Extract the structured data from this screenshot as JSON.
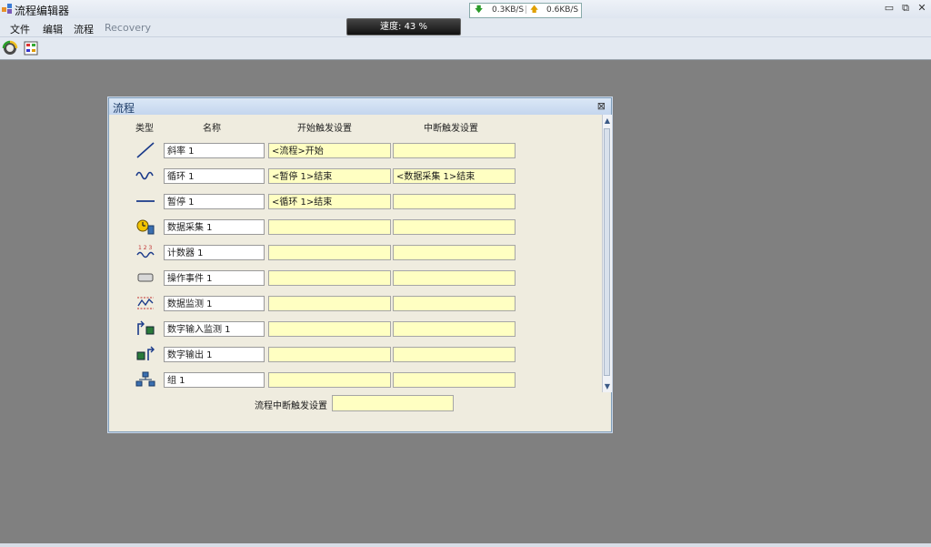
{
  "app": {
    "title": "流程编辑器"
  },
  "window_controls": [
    "minimize-icon",
    "restore-icon",
    "close-icon"
  ],
  "menu": {
    "items": [
      "文件",
      "编辑",
      "流程",
      "Recovery"
    ]
  },
  "toolbar": {
    "buttons": [
      "refresh-icon",
      "edit-flow-icon"
    ]
  },
  "speed": {
    "label": "速度: 43 %"
  },
  "network": {
    "down": "0.3KB/S",
    "up": "0.6KB/S"
  },
  "dialog": {
    "title": "流程",
    "columns": {
      "type": "类型",
      "name": "名称",
      "start": "开始触发设置",
      "stop": "中断触发设置"
    },
    "rows": [
      {
        "icon": "ramp-icon",
        "name": "斜率 1",
        "start": "<流程>开始",
        "stop": ""
      },
      {
        "icon": "cycle-wave-icon",
        "name": "循环 1",
        "start": "<暂停 1>结束",
        "stop": "<数据采集 1>结束"
      },
      {
        "icon": "hold-line-icon",
        "name": "暂停 1",
        "start": "<循环 1>结束",
        "stop": ""
      },
      {
        "icon": "data-acquire-icon",
        "name": "数据采集 1",
        "start": "",
        "stop": ""
      },
      {
        "icon": "counter-icon",
        "name": "计数器 1",
        "start": "",
        "stop": ""
      },
      {
        "icon": "operator-event-icon",
        "name": "操作事件 1",
        "start": "",
        "stop": ""
      },
      {
        "icon": "data-monitor-icon",
        "name": "数据监测 1",
        "start": "",
        "stop": ""
      },
      {
        "icon": "digital-input-icon",
        "name": "数字输入监测 1",
        "start": "",
        "stop": ""
      },
      {
        "icon": "digital-output-icon",
        "name": "数字输出 1",
        "start": "",
        "stop": ""
      },
      {
        "icon": "group-icon",
        "name": "组 1",
        "start": "",
        "stop": ""
      }
    ],
    "footer": {
      "label": "流程中断触发设置",
      "value": ""
    }
  },
  "colors": {
    "desktop": "#808080",
    "dialog_bg": "#efecdf",
    "trigger_field": "#ffffc2"
  }
}
